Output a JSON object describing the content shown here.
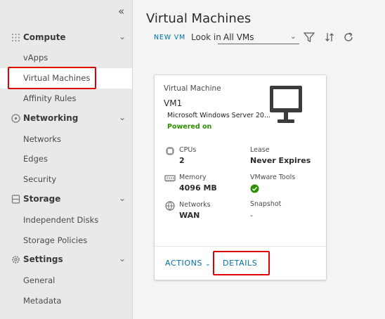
{
  "sidebar": {
    "collapse_icon": "double-chevron-left-icon",
    "sections": [
      {
        "label": "Compute",
        "icon": "compute-grid-icon",
        "items": [
          "vApps",
          "Virtual Machines",
          "Affinity Rules"
        ]
      },
      {
        "label": "Networking",
        "icon": "networking-icon",
        "items": [
          "Networks",
          "Edges",
          "Security"
        ]
      },
      {
        "label": "Storage",
        "icon": "storage-icon",
        "items": [
          "Independent Disks",
          "Storage Policies"
        ]
      },
      {
        "label": "Settings",
        "icon": "settings-gear-icon",
        "items": [
          "General",
          "Metadata"
        ]
      }
    ],
    "active_item": "Virtual Machines"
  },
  "header": {
    "title": "Virtual Machines",
    "new_vm": "NEW VM",
    "look_in_label": "Look in",
    "look_in_value": "All VMs"
  },
  "card": {
    "type_label": "Virtual Machine",
    "name": "VM1",
    "os": "Microsoft Windows Server 20...",
    "status": "Powered on",
    "cpus_label": "CPUs",
    "cpus_value": "2",
    "lease_label": "Lease",
    "lease_value": "Never Expires",
    "memory_label": "Memory",
    "memory_value": "4096 MB",
    "tools_label": "VMware Tools",
    "networks_label": "Networks",
    "networks_value": "WAN",
    "snapshot_label": "Snapshot",
    "snapshot_value": "-",
    "actions_label": "ACTIONS",
    "details_label": "DETAILS"
  },
  "colors": {
    "accent": "#0072a3",
    "status_green": "#2e8f00",
    "highlight": "#e00000"
  }
}
